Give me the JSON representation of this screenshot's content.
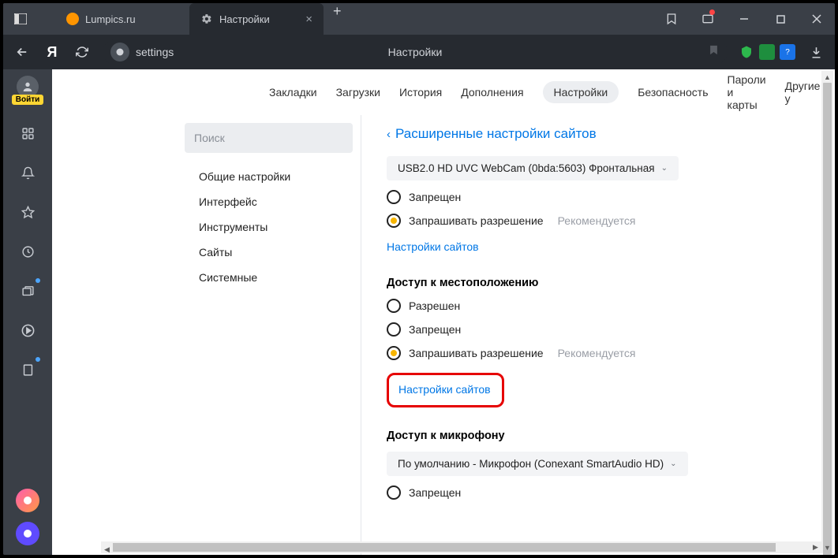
{
  "titlebar": {
    "tabs": [
      {
        "label": "Lumpics.ru"
      },
      {
        "label": "Настройки"
      }
    ]
  },
  "addressbar": {
    "url_text": "settings",
    "page_title": "Настройки"
  },
  "leftbar": {
    "login_badge": "Войти"
  },
  "topnav": {
    "items": [
      "Закладки",
      "Загрузки",
      "История",
      "Дополнения",
      "Настройки",
      "Безопасность",
      "Пароли и карты",
      "Другие у"
    ],
    "active_index": 4
  },
  "settings_sidebar": {
    "search_placeholder": "Поиск",
    "items": [
      "Общие настройки",
      "Интерфейс",
      "Инструменты",
      "Сайты",
      "Системные"
    ]
  },
  "main": {
    "header": "Расширенные настройки сайтов",
    "camera": {
      "dropdown": "USB2.0 HD UVC WebCam (0bda:5603) Фронтальная",
      "opt_denied": "Запрещен",
      "opt_ask": "Запрашивать разрешение",
      "hint": "Рекомендуется",
      "link": "Настройки сайтов"
    },
    "location": {
      "title": "Доступ к местоположению",
      "opt_allowed": "Разрешен",
      "opt_denied": "Запрещен",
      "opt_ask": "Запрашивать разрешение",
      "hint": "Рекомендуется",
      "link": "Настройки сайтов"
    },
    "mic": {
      "title": "Доступ к микрофону",
      "dropdown": "По умолчанию - Микрофон (Conexant SmartAudio HD)",
      "opt_denied": "Запрещен"
    }
  }
}
